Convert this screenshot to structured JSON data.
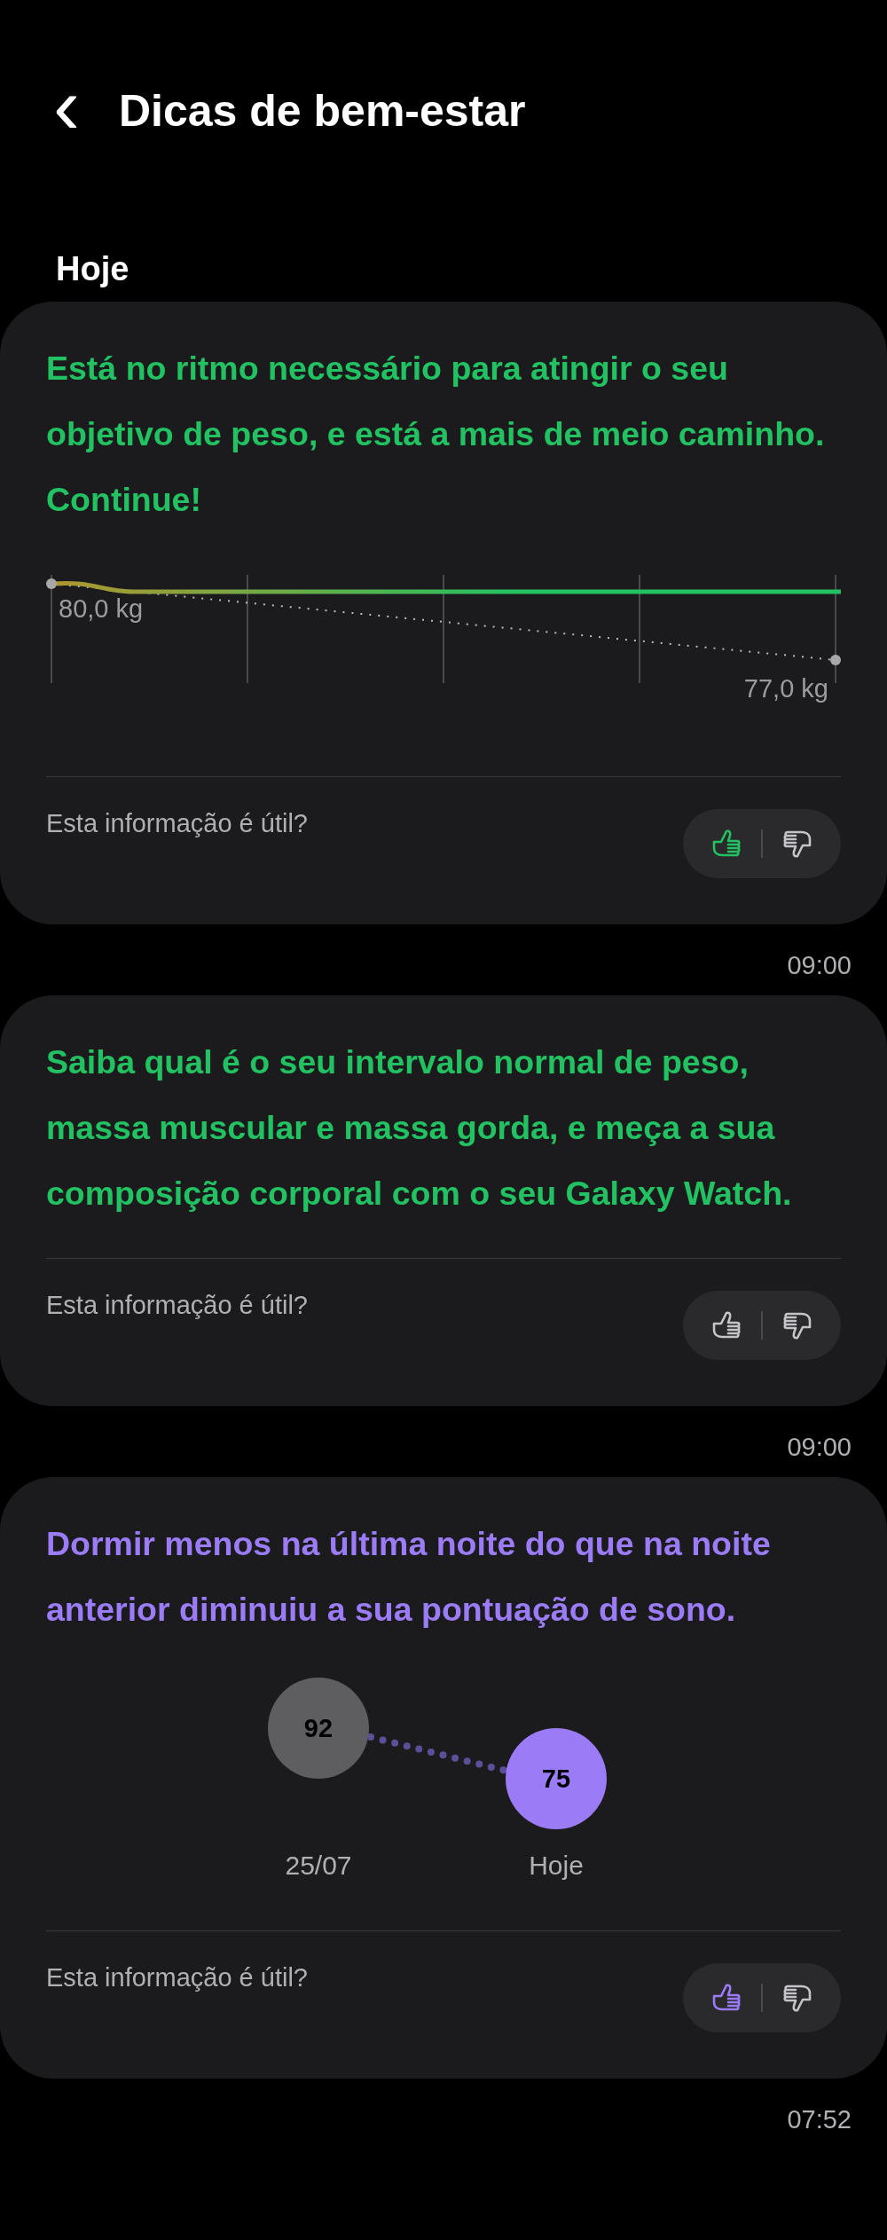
{
  "header": {
    "back": "‹",
    "title": "Dicas de bem-estar"
  },
  "section": "Hoje",
  "cards": [
    {
      "kind": "weight",
      "color": "#22c262",
      "message": "Está no ritmo necessário para atingir o seu objetivo de peso, e está a mais de meio caminho. Continue!",
      "start_label": "80,0 kg",
      "goal_label": "77,0 kg",
      "question": "Esta informação é útil?",
      "liked": true,
      "time": "09:00"
    },
    {
      "kind": "text",
      "color": "#22c262",
      "message": "Saiba qual é o seu intervalo normal de peso, massa muscular e massa gorda, e meça a sua composição corporal com o seu Galaxy Watch.",
      "question": "Esta informação é útil?",
      "liked": false,
      "time": "09:00"
    },
    {
      "kind": "sleep",
      "color": "#9b7cf6",
      "message": "Dormir menos na última noite do que na noite anterior diminuiu a sua pontuação de sono.",
      "scores": [
        {
          "value": "92",
          "label": "25/07",
          "selected": false
        },
        {
          "value": "75",
          "label": "Hoje",
          "selected": true
        }
      ],
      "question": "Esta informação é útil?",
      "liked": true,
      "time": "07:52"
    }
  ]
}
